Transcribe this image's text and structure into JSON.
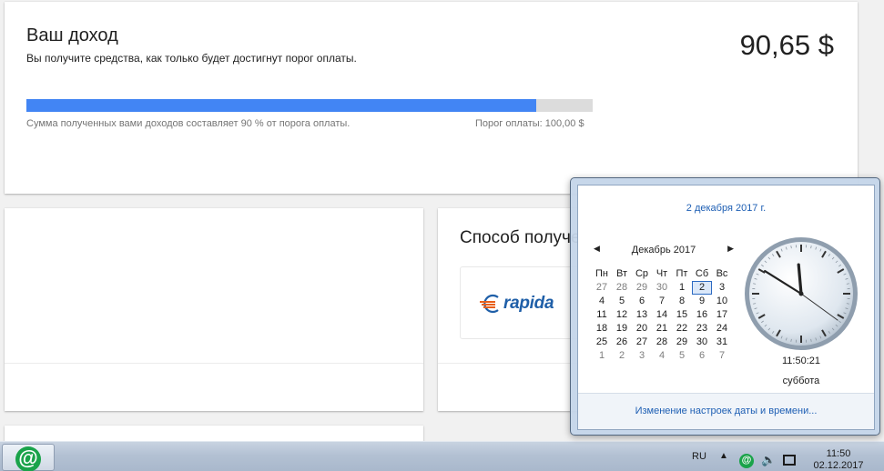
{
  "income": {
    "title": "Ваш доход",
    "subtitle": "Вы получите средства, как только будет достигнут порог оплаты.",
    "amount": "90,65 $",
    "progress_fraction": 0.9,
    "progress_note": "Сумма полученных вами доходов составляет 90 % от порога оплаты.",
    "threshold_note": "Порог оплаты: 100,00 $",
    "progress_color": "#4285f4"
  },
  "payment_method": {
    "title": "Способ получения",
    "logo_text": "rapida",
    "logo_icon": "rapida-logo-icon"
  },
  "calendar": {
    "date_link": "2 декабря 2017 г.",
    "month": "Декабрь 2017",
    "weekdays": [
      "Пн",
      "Вт",
      "Ср",
      "Чт",
      "Пт",
      "Сб",
      "Вс"
    ],
    "weeks": [
      [
        "27",
        "28",
        "29",
        "30",
        "1",
        "2",
        "3"
      ],
      [
        "4",
        "5",
        "6",
        "7",
        "8",
        "9",
        "10"
      ],
      [
        "11",
        "12",
        "13",
        "14",
        "15",
        "16",
        "17"
      ],
      [
        "18",
        "19",
        "20",
        "21",
        "22",
        "23",
        "24"
      ],
      [
        "25",
        "26",
        "27",
        "28",
        "29",
        "30",
        "31"
      ],
      [
        "1",
        "2",
        "3",
        "4",
        "5",
        "6",
        "7"
      ]
    ],
    "selected_day": "2",
    "time": "11:50:21",
    "weekday": "суббота",
    "settings_link": "Изменение настроек даты и времени...",
    "clock": {
      "hours": 11,
      "minutes": 50,
      "seconds": 21
    }
  },
  "taskbar": {
    "app_icon": "mail-ru-agent-icon",
    "language": "RU",
    "tray_arrow": "▲",
    "time": "11:50",
    "date": "02.12.2017"
  }
}
